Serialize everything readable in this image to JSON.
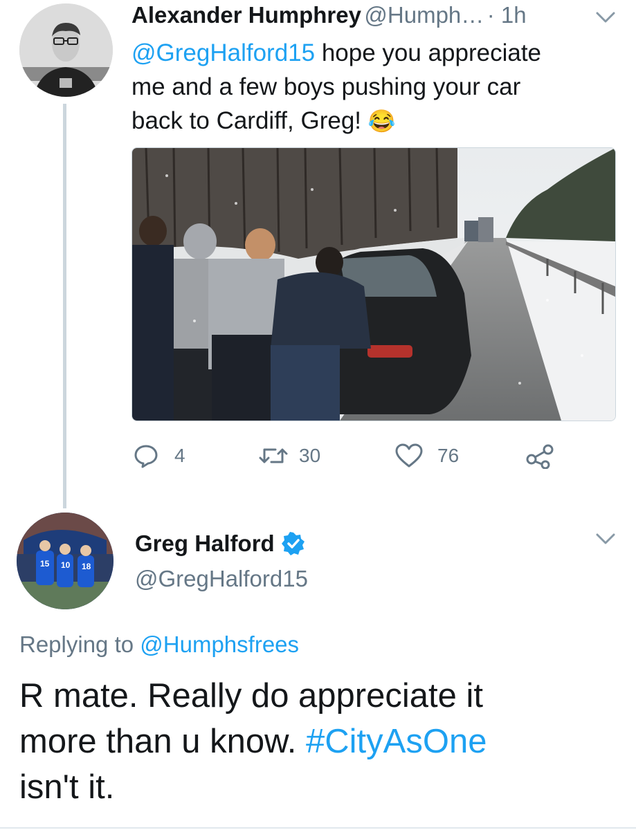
{
  "tweet1": {
    "name": "Alexander Humphrey",
    "handle": "@Humph…",
    "time": "· 1h",
    "mention": "@GregHalford15",
    "text_after_mention": " hope you appreciate",
    "text_line2": "me and a few boys pushing your car",
    "text_line3": "back to Cardiff, Greg!",
    "emoji": "😂",
    "actions": {
      "replies": "4",
      "retweets": "30",
      "likes": "76"
    }
  },
  "tweet2": {
    "name": "Greg Halford",
    "handle": "@GregHalford15",
    "replying_label": "Replying to",
    "replying_handle": "@Humphsfrees",
    "text_line1": "R mate. Really do appreciate it",
    "text_line2_prefix": "more than u know. ",
    "hashtag": "#CityAsOne",
    "text_line3": "isn't it."
  },
  "colors": {
    "link": "#1da1f2",
    "muted": "#657786",
    "verified": "#1da1f2"
  },
  "icons": [
    "chevron-down-icon",
    "reply-icon",
    "retweet-icon",
    "like-icon",
    "share-icon",
    "verified-icon"
  ]
}
